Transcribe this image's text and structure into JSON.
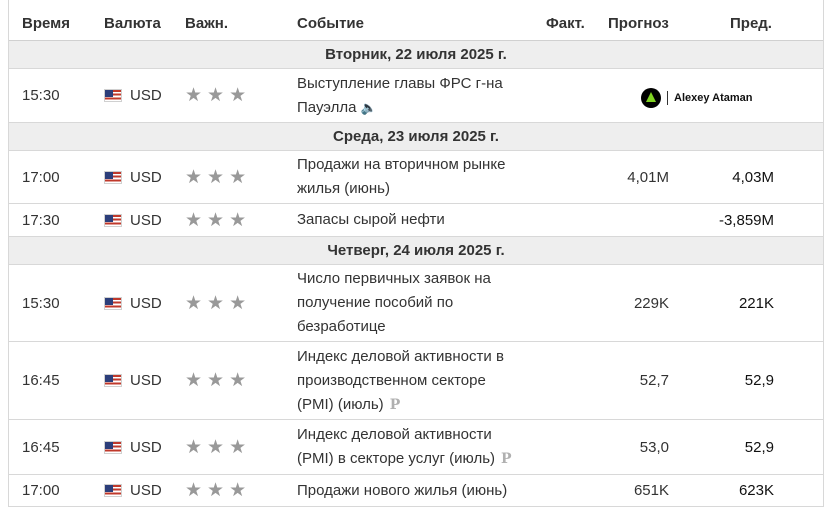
{
  "header": {
    "time": "Время",
    "currency": "Валюта",
    "importance": "Важн.",
    "event": "Событие",
    "actual": "Факт.",
    "forecast": "Прогноз",
    "previous": "Пред."
  },
  "watermark": "Alexey Ataman",
  "days": [
    {
      "label": "Вторник, 22 июля 2025 г.",
      "events": [
        {
          "time": "15:30",
          "currency": "USD",
          "stars": 3,
          "event_lines": [
            "Выступление главы ФРС г-на",
            "Пауэлла"
          ],
          "actual": "",
          "forecast": "",
          "previous": "",
          "icon": "speaker-icon"
        }
      ]
    },
    {
      "label": "Среда, 23 июля 2025 г.",
      "events": [
        {
          "time": "17:00",
          "currency": "USD",
          "stars": 3,
          "event_lines": [
            "Продажи на вторичном рынке",
            "жилья (июнь)"
          ],
          "actual": "",
          "forecast": "4,01M",
          "previous": "4,03M"
        },
        {
          "time": "17:30",
          "currency": "USD",
          "stars": 3,
          "event_lines": [
            "Запасы сырой нефти"
          ],
          "actual": "",
          "forecast": "",
          "previous": "-3,859M"
        }
      ]
    },
    {
      "label": "Четверг, 24 июля 2025 г.",
      "events": [
        {
          "time": "15:30",
          "currency": "USD",
          "stars": 3,
          "event_lines": [
            "Число первичных заявок на",
            "получение пособий по",
            "безработице"
          ],
          "actual": "",
          "forecast": "229K",
          "previous": "221K"
        },
        {
          "time": "16:45",
          "currency": "USD",
          "stars": 3,
          "event_lines": [
            "Индекс деловой активности в",
            "производственном секторе",
            "(PMI) (июль)"
          ],
          "actual": "",
          "forecast": "52,7",
          "previous": "52,9",
          "icon": "preliminary-icon"
        },
        {
          "time": "16:45",
          "currency": "USD",
          "stars": 3,
          "event_lines": [
            "Индекс деловой активности",
            "(PMI) в секторе услуг (июль)"
          ],
          "actual": "",
          "forecast": "53,0",
          "previous": "52,9",
          "icon": "preliminary-icon"
        },
        {
          "time": "17:00",
          "currency": "USD",
          "stars": 3,
          "event_lines": [
            "Продажи нового жилья (июнь)"
          ],
          "actual": "",
          "forecast": "651K",
          "previous": "623K"
        }
      ]
    }
  ],
  "glyphs": {
    "star": "★",
    "speaker": "🔈",
    "preliminary": "P"
  }
}
